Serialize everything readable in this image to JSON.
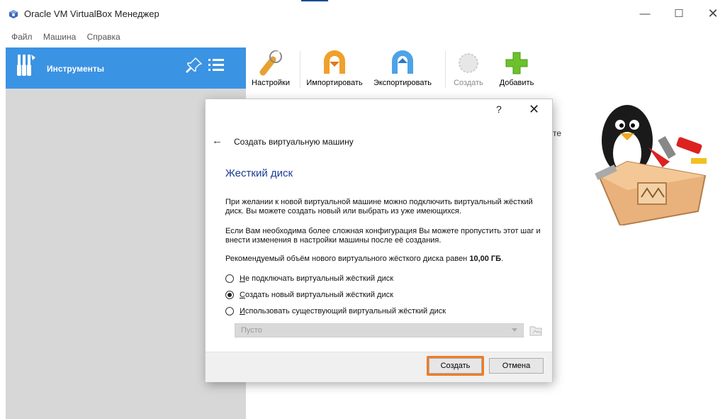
{
  "window": {
    "title": "Oracle VM VirtualBox Менеджер",
    "controls": {
      "minimize": "—",
      "maximize": "☐",
      "close": "✕"
    }
  },
  "menu": {
    "items": [
      "Файл",
      "Машина",
      "Справка"
    ]
  },
  "sidebar": {
    "tools_label": "Инструменты",
    "icons": [
      "tools-icon",
      "pin-icon",
      "list-icon"
    ]
  },
  "toolbar": {
    "buttons": [
      {
        "label": "Настройки",
        "icon": "settings-icon",
        "enabled": true
      },
      {
        "label": "Импортировать",
        "icon": "import-icon",
        "enabled": true
      },
      {
        "label": "Экспортировать",
        "icon": "export-icon",
        "enabled": true
      },
      {
        "label": "Создать",
        "icon": "new-icon",
        "enabled": false
      },
      {
        "label": "Добавить",
        "icon": "add-icon",
        "enabled": true
      }
    ]
  },
  "background": {
    "partial_text": "те"
  },
  "dialog": {
    "help": "?",
    "close": "✕",
    "back": "←",
    "title": "Создать виртуальную машину",
    "section_title": "Жесткий диск",
    "paragraph1": "При желании к новой виртуальной машине можно подключить виртуальный жёсткий диск. Вы можете создать новый или выбрать из уже имеющихся.",
    "paragraph2": "Если Вам необходима более сложная конфигурация Вы можете пропустить этот шаг и внести изменения в настройки машины после её создания.",
    "paragraph3_prefix": "Рекомендуемый объём нового виртуального жёсткого диска равен ",
    "paragraph3_value": "10,00 ГБ",
    "paragraph3_suffix": ".",
    "options": [
      {
        "underline": "Н",
        "rest": "е подключать виртуальный жёсткий диск",
        "checked": false
      },
      {
        "underline": "С",
        "rest": "оздать новый виртуальный жёсткий диск",
        "checked": true
      },
      {
        "underline": "И",
        "rest": "спользовать существующий виртуальный жёсткий диск",
        "checked": false
      }
    ],
    "disk_select": {
      "value": "Пусто",
      "enabled": false
    },
    "buttons": {
      "create": "Создать",
      "cancel": "Отмена"
    },
    "highlight_color": "#f07b23"
  },
  "colors": {
    "sidebar_selected": "#3b93e4",
    "sidebar_bg": "#d7d7d7",
    "section_title": "#1c3d94"
  }
}
